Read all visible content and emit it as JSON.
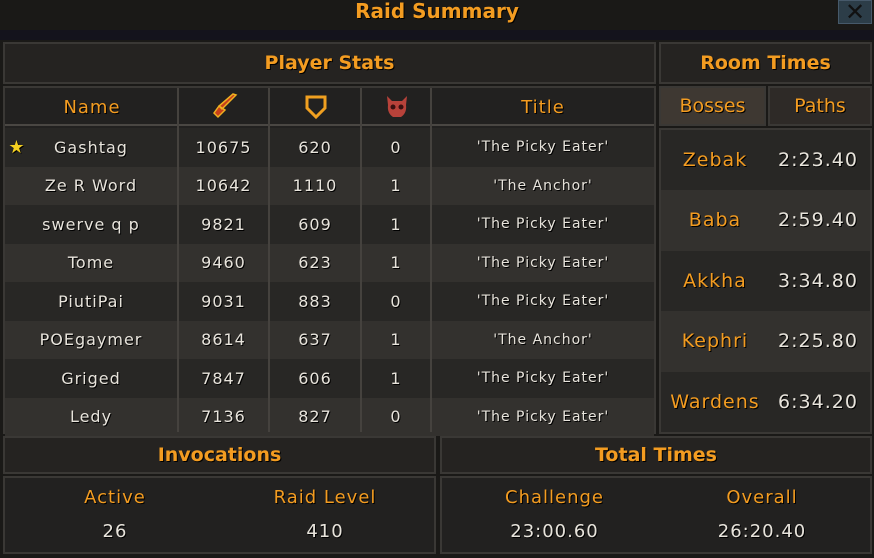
{
  "window": {
    "title": "Raid Summary",
    "close": "✕"
  },
  "player_stats": {
    "title": "Player Stats",
    "columns": {
      "name": "Name",
      "damage_icon": "sword-icon",
      "defence_icon": "shield-icon",
      "deaths_icon": "skull-icon",
      "title": "Title"
    },
    "rows": [
      {
        "name": "Gashtag",
        "damage": "10675",
        "defence": "620",
        "deaths": "0",
        "title": "'The Picky Eater'",
        "star": true
      },
      {
        "name": "Ze R Word",
        "damage": "10642",
        "defence": "1110",
        "deaths": "1",
        "title": "'The Anchor'"
      },
      {
        "name": "swerve q p",
        "damage": "9821",
        "defence": "609",
        "deaths": "1",
        "title": "'The Picky Eater'"
      },
      {
        "name": "Tome",
        "damage": "9460",
        "defence": "623",
        "deaths": "1",
        "title": "'The Picky Eater'"
      },
      {
        "name": "PiutiPai",
        "damage": "9031",
        "defence": "883",
        "deaths": "0",
        "title": "'The Picky Eater'"
      },
      {
        "name": "POEgaymer",
        "damage": "8614",
        "defence": "637",
        "deaths": "1",
        "title": "'The Anchor'"
      },
      {
        "name": "Griged",
        "damage": "7847",
        "defence": "606",
        "deaths": "1",
        "title": "'The Picky Eater'"
      },
      {
        "name": "Ledy",
        "damage": "7136",
        "defence": "827",
        "deaths": "0",
        "title": "'The Picky Eater'"
      }
    ]
  },
  "room_times": {
    "title": "Room Times",
    "tabs": [
      "Bosses",
      "Paths"
    ],
    "active_tab": "Bosses",
    "rooms": [
      {
        "name": "Zebak",
        "time": "2:23.40"
      },
      {
        "name": "Baba",
        "time": "2:59.40"
      },
      {
        "name": "Akkha",
        "time": "3:34.80"
      },
      {
        "name": "Kephri",
        "time": "2:25.80"
      },
      {
        "name": "Wardens",
        "time": "6:34.20"
      }
    ]
  },
  "invocations": {
    "title": "Invocations",
    "active_label": "Active",
    "active": "26",
    "raid_level_label": "Raid Level",
    "raid_level": "410"
  },
  "total_times": {
    "title": "Total Times",
    "challenge_label": "Challenge",
    "challenge": "23:00.60",
    "overall_label": "Overall",
    "overall": "26:20.40"
  }
}
